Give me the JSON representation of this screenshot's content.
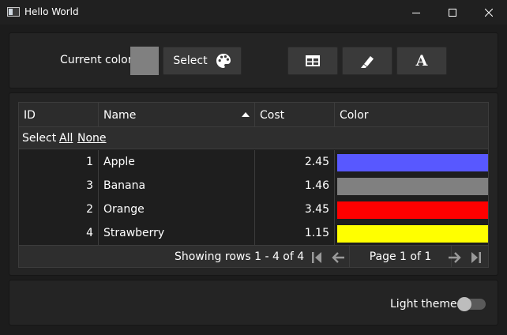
{
  "window": {
    "title": "Hello World",
    "controls": [
      "minimize",
      "maximize",
      "close"
    ]
  },
  "toolbar": {
    "current_color_label": "Current color:",
    "current_color": "#808080",
    "select_label": "Select",
    "select_icon": "palette-icon",
    "tool_icons": [
      "table-icon",
      "brush-icon",
      "font-icon"
    ],
    "font_glyph": "A"
  },
  "table": {
    "columns": [
      "ID",
      "Name",
      "Cost",
      "Color"
    ],
    "sorted_column": "Name",
    "sort_direction": "ascending",
    "select_label": "Select",
    "select_all": "All",
    "select_none": "None",
    "rows": [
      {
        "id": "1",
        "name": "Apple",
        "cost": "2.45",
        "color": "#5858ff"
      },
      {
        "id": "3",
        "name": "Banana",
        "cost": "1.46",
        "color": "#808080"
      },
      {
        "id": "2",
        "name": "Orange",
        "cost": "3.45",
        "color": "#ff0000"
      },
      {
        "id": "4",
        "name": "Strawberry",
        "cost": "1.15",
        "color": "#ffff00"
      }
    ],
    "footer": {
      "rows_info": "Showing rows 1 - 4 of 4",
      "page_info": "Page 1 of 1"
    }
  },
  "settings": {
    "theme_label": "Light theme",
    "light_theme_enabled": false
  },
  "colors": {
    "background": "#1c1c1c",
    "panel": "#242424",
    "button": "#3a3a3a",
    "text": "#ffffff"
  }
}
